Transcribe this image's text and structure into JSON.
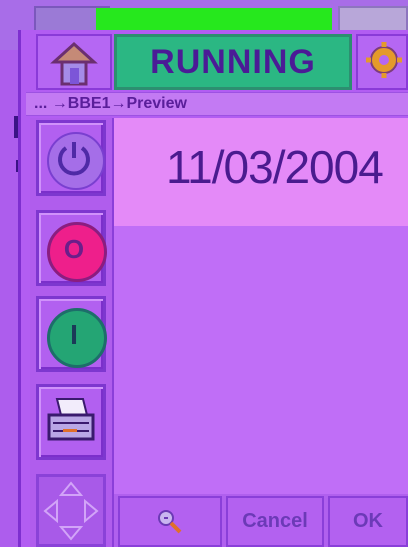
{
  "header": {
    "status_text": "RUNNING",
    "home_icon": "home-icon",
    "gear_icon": "gear-icon"
  },
  "breadcrumb": {
    "text": "... →BBE1→Preview"
  },
  "main": {
    "date": "11/03/2004"
  },
  "tools": [
    {
      "name": "power-icon"
    },
    {
      "name": "off-icon",
      "label": "O"
    },
    {
      "name": "on-icon",
      "label": "I"
    },
    {
      "name": "printer-icon"
    },
    {
      "name": "navigation-arrows-icon"
    }
  ],
  "actions": {
    "search_icon": "magnifier-icon",
    "cancel_label": "Cancel",
    "ok_label": "OK"
  },
  "colors": {
    "background": "#b15cf0",
    "status_green": "#2bb783",
    "date_bg": "#e48af8",
    "off_red": "#ee1f8b",
    "on_green": "#24a574"
  }
}
